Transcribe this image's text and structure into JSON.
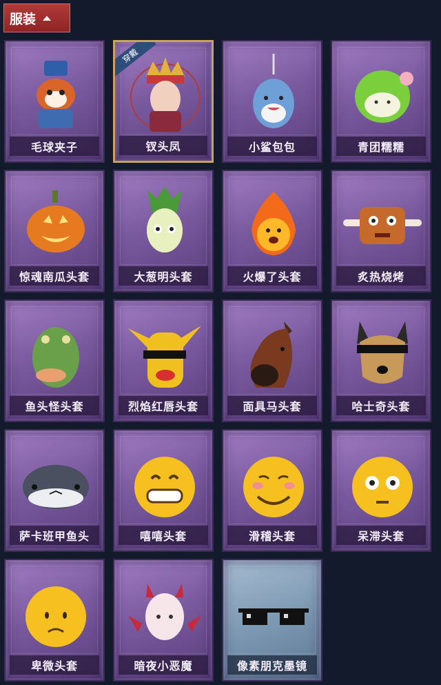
{
  "category": {
    "label": "服装"
  },
  "items": [
    {
      "name": "毛球夹子"
    },
    {
      "name": "钗头凤",
      "badge": "穿戴"
    },
    {
      "name": "小鲨包包"
    },
    {
      "name": "青团糯糯"
    },
    {
      "name": "惊魂南瓜头套"
    },
    {
      "name": "大葱明头套"
    },
    {
      "name": "火爆了头套"
    },
    {
      "name": "炙热烧烤"
    },
    {
      "name": "鱼头怪头套"
    },
    {
      "name": "烈焰红唇头套"
    },
    {
      "name": "面具马头套"
    },
    {
      "name": "哈士奇头套"
    },
    {
      "name": "萨卡班甲鱼头"
    },
    {
      "name": "嘻嘻头套"
    },
    {
      "name": "滑稽头套"
    },
    {
      "name": "呆滞头套"
    },
    {
      "name": "卑微头套"
    },
    {
      "name": "暗夜小恶魔"
    },
    {
      "name": "像素朋克墨镜"
    }
  ]
}
